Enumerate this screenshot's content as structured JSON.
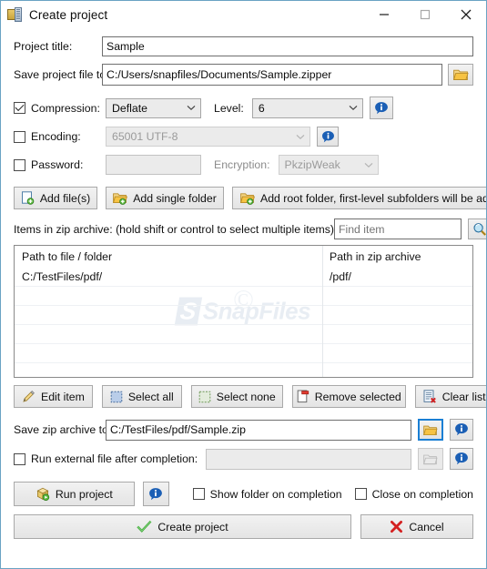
{
  "window": {
    "title": "Create project",
    "icon": "archive-zipper-icon",
    "controls": {
      "minimize": "minimize-icon",
      "maximize": "maximize-icon",
      "close": "close-icon"
    },
    "border_color": "#6aa3c4"
  },
  "fields": {
    "project_title_label": "Project title:",
    "project_title_value": "Sample",
    "save_project_label": "Save project file to:",
    "save_project_value": "C:/Users/snapfiles/Documents/Sample.zipper",
    "save_project_browse_icon": "folder-open-icon"
  },
  "compression": {
    "checkbox_label": "Compression:",
    "checked": true,
    "method_value": "Deflate",
    "level_label": "Level:",
    "level_value": "6",
    "info_icon": "info-icon",
    "encoding_label": "Encoding:",
    "encoding_checked": false,
    "encoding_value": "65001 UTF-8",
    "encoding_info_icon": "info-icon",
    "password_label": "Password:",
    "password_checked": false,
    "password_value": "",
    "encryption_label": "Encryption:",
    "encryption_value": "PkzipWeak"
  },
  "add_buttons": [
    {
      "label": "Add file(s)",
      "icon": "file-add-icon"
    },
    {
      "label": "Add single folder",
      "icon": "folder-add-icon"
    },
    {
      "label": "Add root folder, first-level subfolders will be added",
      "icon": "folder-add-icon"
    }
  ],
  "items_section": {
    "label": "Items in zip archive: (hold shift or control to select multiple items)",
    "find_placeholder": "Find item",
    "find_value": "",
    "find_icon": "search-magnifier-icon"
  },
  "list": {
    "columns": [
      "Path to file / folder",
      "Path in zip archive"
    ],
    "rows": [
      {
        "path": "C:/TestFiles/pdf/",
        "zip_path": "/pdf/"
      }
    ],
    "watermark": "SnapFiles",
    "watermark_mark": "©"
  },
  "list_buttons": [
    {
      "label": "Edit item",
      "icon": "pencil-edit-icon"
    },
    {
      "label": "Select all",
      "icon": "select-all-icon"
    },
    {
      "label": "Select none",
      "icon": "select-none-icon"
    },
    {
      "label": "Remove selected",
      "icon": "remove-item-icon"
    },
    {
      "label": "Clear list",
      "icon": "clear-list-icon"
    }
  ],
  "output": {
    "save_zip_label": "Save zip archive to:",
    "save_zip_value": "C:/TestFiles/pdf/Sample.zip",
    "save_zip_browse_icon": "folder-open-icon",
    "save_zip_info_icon": "info-icon",
    "run_external_label": "Run external file after completion:",
    "run_external_checked": false,
    "run_external_value": "",
    "run_external_browse_icon": "folder-open-icon",
    "run_external_info_icon": "info-icon"
  },
  "footer": {
    "run_project_label": "Run project",
    "run_project_icon": "package-run-icon",
    "run_info_icon": "info-icon",
    "show_folder_label": "Show folder on completion",
    "show_folder_checked": false,
    "close_on_completion_label": "Close on completion",
    "close_on_completion_checked": false,
    "create_label": "Create project",
    "create_icon": "green-check-icon",
    "cancel_label": "Cancel",
    "cancel_icon": "red-x-icon"
  },
  "colors": {
    "accent_blue": "#1a7fd4",
    "info_blue": "#1b5fb5",
    "folder_yellow": "#f0c24b",
    "check_green": "#33a02c",
    "cancel_red": "#d42020"
  }
}
